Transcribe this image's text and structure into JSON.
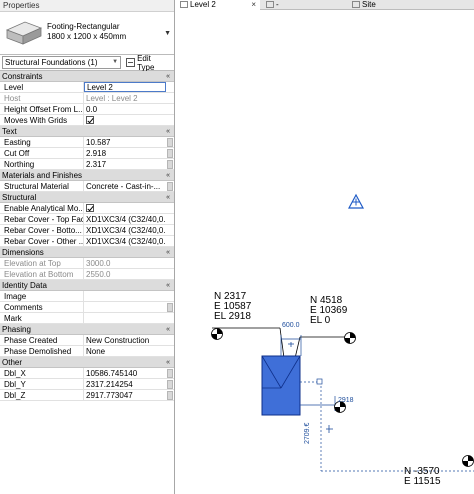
{
  "properties": {
    "title": "Properties",
    "type_name": "Footing-Rectangular",
    "type_size": "1800 x 1200 x 450mm",
    "instance_selector": "Structural Foundations (1)",
    "edit_type_label": "Edit Type"
  },
  "groups": {
    "constraints": "Constraints",
    "text": "Text",
    "materials": "Materials and Finishes",
    "structural": "Structural",
    "dimensions": "Dimensions",
    "identity": "Identity Data",
    "phasing": "Phasing",
    "other": "Other"
  },
  "rows": {
    "level": {
      "name": "Level",
      "value": "Level 2"
    },
    "host": {
      "name": "Host",
      "value": "Level : Level 2"
    },
    "height_offset": {
      "name": "Height Offset From L...",
      "value": "0.0"
    },
    "moves_grids": {
      "name": "Moves With Grids"
    },
    "easting": {
      "name": "Easting",
      "value": "10.587"
    },
    "cut_off": {
      "name": "Cut Off",
      "value": "2.918"
    },
    "northing": {
      "name": "Northing",
      "value": "2.317"
    },
    "struct_material": {
      "name": "Structural Material",
      "value": "Concrete - Cast-in-..."
    },
    "analytical": {
      "name": "Enable Analytical Mo..."
    },
    "rebar_top": {
      "name": "Rebar Cover - Top Face",
      "value": "XD1\\XC3/4 (C32/40,0..."
    },
    "rebar_bottom": {
      "name": "Rebar Cover - Botto...",
      "value": "XD1\\XC3/4 (C32/40,0..."
    },
    "rebar_other": {
      "name": "Rebar Cover - Other ...",
      "value": "XD1\\XC3/4 (C32/40,0..."
    },
    "elev_top": {
      "name": "Elevation at Top",
      "value": "3000.0"
    },
    "elev_bottom": {
      "name": "Elevation at Bottom",
      "value": "2550.0"
    },
    "image": {
      "name": "Image",
      "value": ""
    },
    "comments": {
      "name": "Comments",
      "value": ""
    },
    "mark": {
      "name": "Mark",
      "value": ""
    },
    "phase_created": {
      "name": "Phase Created",
      "value": "New Construction"
    },
    "phase_demolished": {
      "name": "Phase Demolished",
      "value": "None"
    },
    "dbl_x": {
      "name": "Dbl_X",
      "value": "10586.745140"
    },
    "dbl_y": {
      "name": "Dbl_Y",
      "value": "2317.214254"
    },
    "dbl_z": {
      "name": "Dbl_Z",
      "value": "2917.773047"
    }
  },
  "tabs": [
    {
      "label": "Level 2"
    },
    {
      "label": "-"
    },
    {
      "label": "Site"
    }
  ],
  "canvas": {
    "spot1": {
      "n": "N 2317",
      "e": "E 10587",
      "el": "EL 2918"
    },
    "spot2": {
      "n": "N 4518",
      "e": "E 10369",
      "el": "EL 0"
    },
    "spot3": {
      "n": "N -3570",
      "e": "E 11515"
    },
    "dim_600": "600.0",
    "dim_2918": "2918",
    "dim_2709": "2709.€"
  },
  "colors": {
    "accent": "#1f5bc6",
    "footing_fill": "#3f6fd8",
    "group_header": "#dcdcdc"
  }
}
